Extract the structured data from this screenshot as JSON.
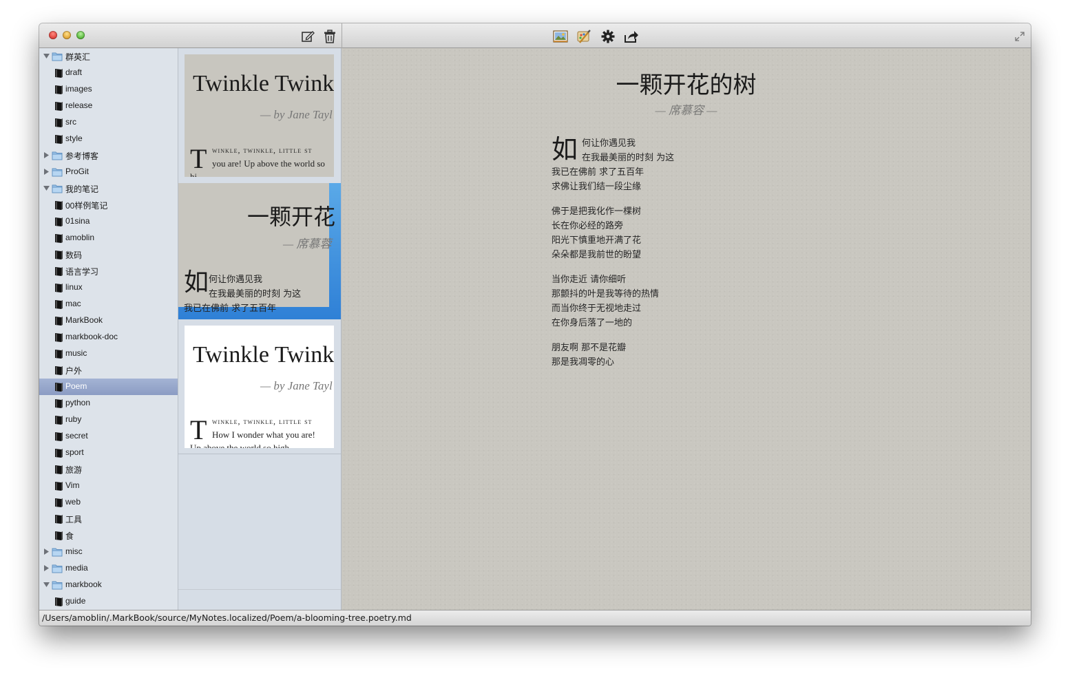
{
  "window": {
    "toolbar_icons": [
      "compose-icon",
      "trash-icon",
      "insert-image-icon",
      "theme-icon",
      "gear-icon",
      "share-icon",
      "fullscreen-icon"
    ]
  },
  "sidebar": {
    "items": [
      {
        "label": "群英汇",
        "type": "folder",
        "expanded": true
      },
      {
        "label": "draft",
        "type": "notebook"
      },
      {
        "label": "images",
        "type": "notebook"
      },
      {
        "label": "release",
        "type": "notebook"
      },
      {
        "label": "src",
        "type": "notebook"
      },
      {
        "label": "style",
        "type": "notebook"
      },
      {
        "label": "参考博客",
        "type": "folder",
        "expanded": false
      },
      {
        "label": "ProGit",
        "type": "folder",
        "expanded": false
      },
      {
        "label": "我的笔记",
        "type": "folder",
        "expanded": true
      },
      {
        "label": "00样例笔记",
        "type": "notebook"
      },
      {
        "label": "01sina",
        "type": "notebook"
      },
      {
        "label": "amoblin",
        "type": "notebook"
      },
      {
        "label": "数码",
        "type": "notebook"
      },
      {
        "label": "语言学习",
        "type": "notebook"
      },
      {
        "label": "linux",
        "type": "notebook"
      },
      {
        "label": "mac",
        "type": "notebook"
      },
      {
        "label": "MarkBook",
        "type": "notebook"
      },
      {
        "label": "markbook-doc",
        "type": "notebook"
      },
      {
        "label": "music",
        "type": "notebook"
      },
      {
        "label": "户外",
        "type": "notebook"
      },
      {
        "label": "Poem",
        "type": "notebook",
        "selected": true
      },
      {
        "label": "python",
        "type": "notebook"
      },
      {
        "label": "ruby",
        "type": "notebook"
      },
      {
        "label": "secret",
        "type": "notebook"
      },
      {
        "label": "sport",
        "type": "notebook"
      },
      {
        "label": "旅游",
        "type": "notebook"
      },
      {
        "label": "Vim",
        "type": "notebook"
      },
      {
        "label": "web",
        "type": "notebook"
      },
      {
        "label": "工具",
        "type": "notebook"
      },
      {
        "label": "食",
        "type": "notebook"
      },
      {
        "label": "misc",
        "type": "folder",
        "expanded": false
      },
      {
        "label": "media",
        "type": "folder",
        "expanded": false
      },
      {
        "label": "markbook",
        "type": "folder",
        "expanded": true
      },
      {
        "label": "guide",
        "type": "notebook"
      }
    ]
  },
  "notes": [
    {
      "title": "Twinkle Twink",
      "author": "— by Jane Tayl",
      "dropcap": "T",
      "line1": "winkle, twinkle, little st",
      "line2": "you are! Up above the world so",
      "line3": "hi",
      "style": "paper"
    },
    {
      "title": "一颗开花",
      "author": "— 席慕蓉",
      "dropcap": "如",
      "line1": "何让你遇见我",
      "line2": "在我最美丽的时刻 为这",
      "line3": "我已在佛前 求了五百年",
      "style": "paper",
      "selected": true
    },
    {
      "title": "Twinkle Twink",
      "author": "— by Jane Tayl",
      "dropcap": "T",
      "line1": "winkle, twinkle, little st",
      "line2": "How I wonder what you are!",
      "line3": "Up above the world so high",
      "style": "white"
    }
  ],
  "document": {
    "title": "一颗开花的树",
    "author": "— 席慕容 —",
    "dropcap": "如",
    "lines": [
      "何让你遇见我",
      "在我最美丽的时刻 为这",
      "我已在佛前 求了五百年",
      "求佛让我们结一段尘缘",
      "佛于是把我化作一棵树",
      "长在你必经的路旁",
      "阳光下慎重地开满了花",
      "朵朵都是我前世的盼望",
      "当你走近 请你细听",
      "那颤抖的叶是我等待的热情",
      "而当你终于无视地走过",
      "在你身后落了一地的",
      "朋友啊 那不是花瓣",
      "那是我凋零的心"
    ]
  },
  "statusbar": {
    "path": "/Users/amoblin/.MarkBook/source/MyNotes.localized/Poem/a-blooming-tree.poetry.md"
  },
  "colors": {
    "paper": "#c9c7c0",
    "selection_blue": "#3a8ee0",
    "sidebar_selected": "#8b9cc3"
  }
}
